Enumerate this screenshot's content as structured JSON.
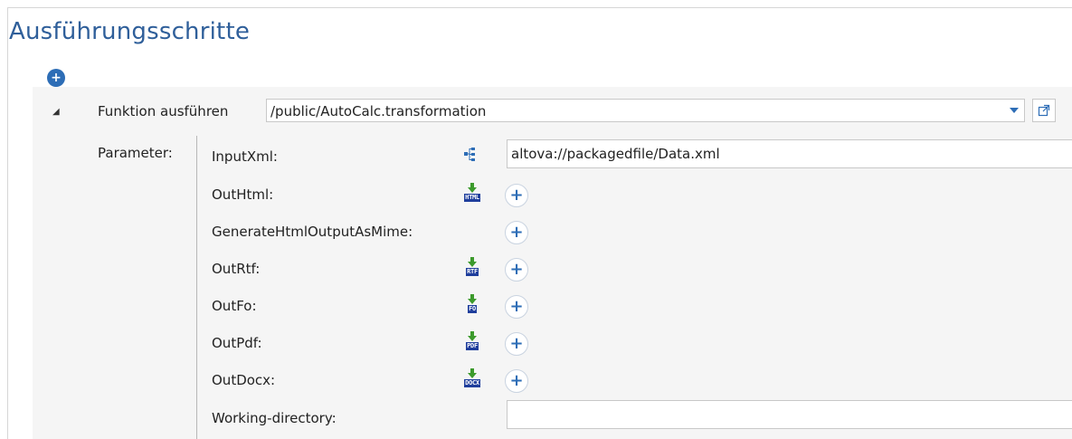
{
  "page": {
    "title": "Ausführungsschritte"
  },
  "step": {
    "label": "Funktion ausführen",
    "function_path": "/public/AutoCalc.transformation"
  },
  "parameters": {
    "label": "Parameter:",
    "items": [
      {
        "name": "InputXml:",
        "icon": "tree-structure-icon",
        "value": "altova://packagedfile/Data.xml"
      },
      {
        "name": "OutHtml:",
        "icon": "html-output-icon",
        "tag": "HTML"
      },
      {
        "name": "GenerateHtmlOutputAsMime:",
        "icon": ""
      },
      {
        "name": "OutRtf:",
        "icon": "rtf-output-icon",
        "tag": "RTF"
      },
      {
        "name": "OutFo:",
        "icon": "fo-output-icon",
        "tag": "FO"
      },
      {
        "name": "OutPdf:",
        "icon": "pdf-output-icon",
        "tag": "PDF"
      },
      {
        "name": "OutDocx:",
        "icon": "docx-output-icon",
        "tag": "DOCX"
      },
      {
        "name": "Working-directory:",
        "value": ""
      }
    ]
  },
  "colors": {
    "accent": "#2d6db6",
    "title": "#2f5f9a",
    "tag_bg": "#1f3e9c",
    "arrow_green": "#3c9a2c"
  }
}
